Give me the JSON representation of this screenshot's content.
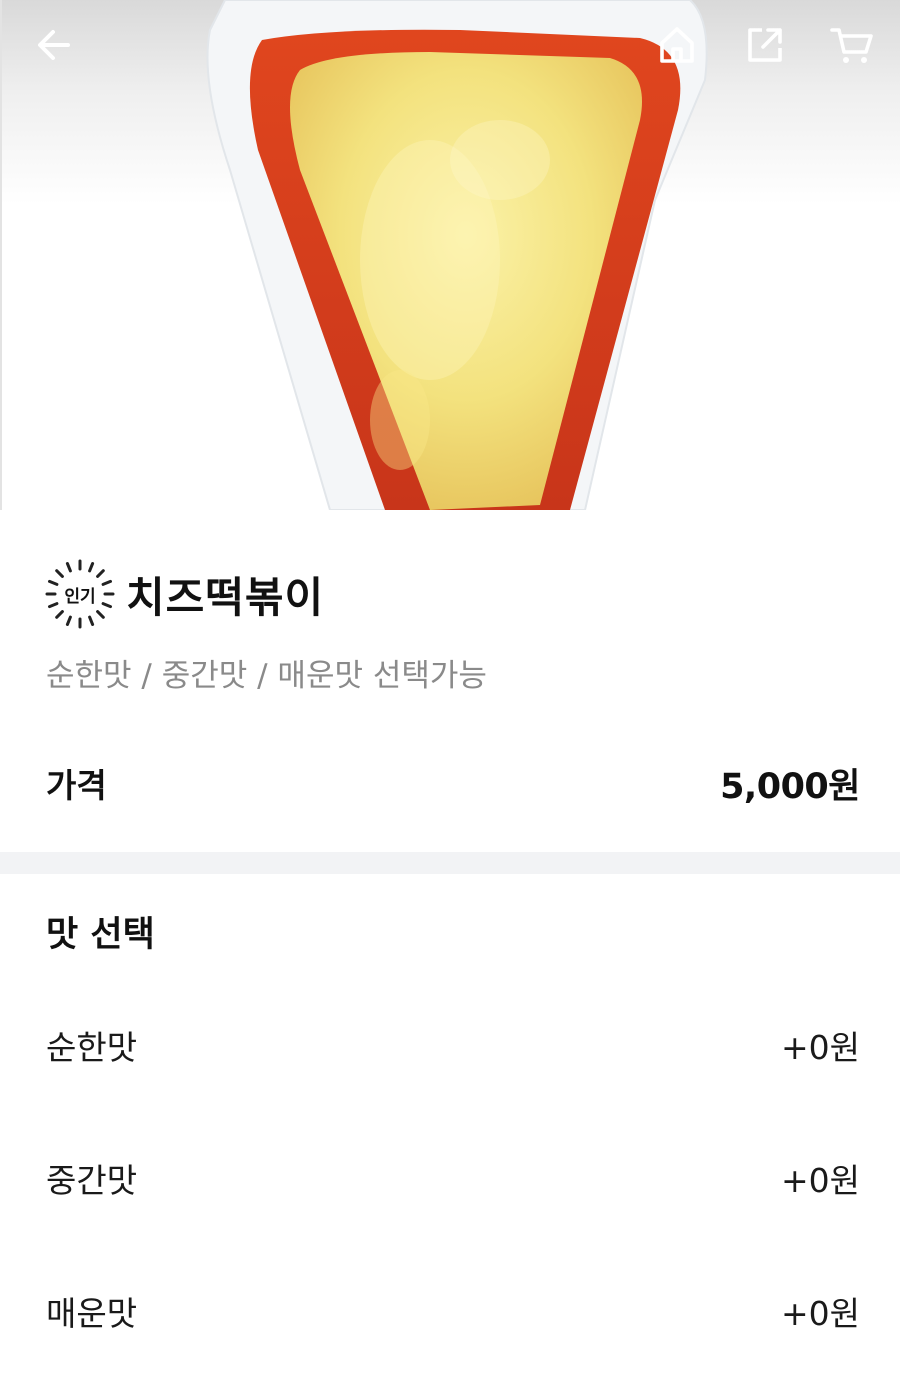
{
  "header": {
    "back_icon": "arrow-left-icon",
    "home_icon": "home-icon",
    "share_icon": "share-icon",
    "cart_icon": "cart-icon"
  },
  "product": {
    "badge": "인기",
    "name": "치즈떡볶이",
    "description": "순한맛 / 중간맛 / 매운맛 선택가능",
    "price_label": "가격",
    "price_value": "5,000원"
  },
  "options_section": {
    "title": "맛 선택",
    "options": [
      {
        "name": "순한맛",
        "price": "+0원"
      },
      {
        "name": "중간맛",
        "price": "+0원"
      },
      {
        "name": "매운맛",
        "price": "+0원"
      }
    ]
  },
  "colors": {
    "sauce": "#d8401c",
    "cheese": "#f3e27e",
    "container": "#eef1f4",
    "divider": "#f2f3f5",
    "muted_text": "#8a8a8a"
  }
}
